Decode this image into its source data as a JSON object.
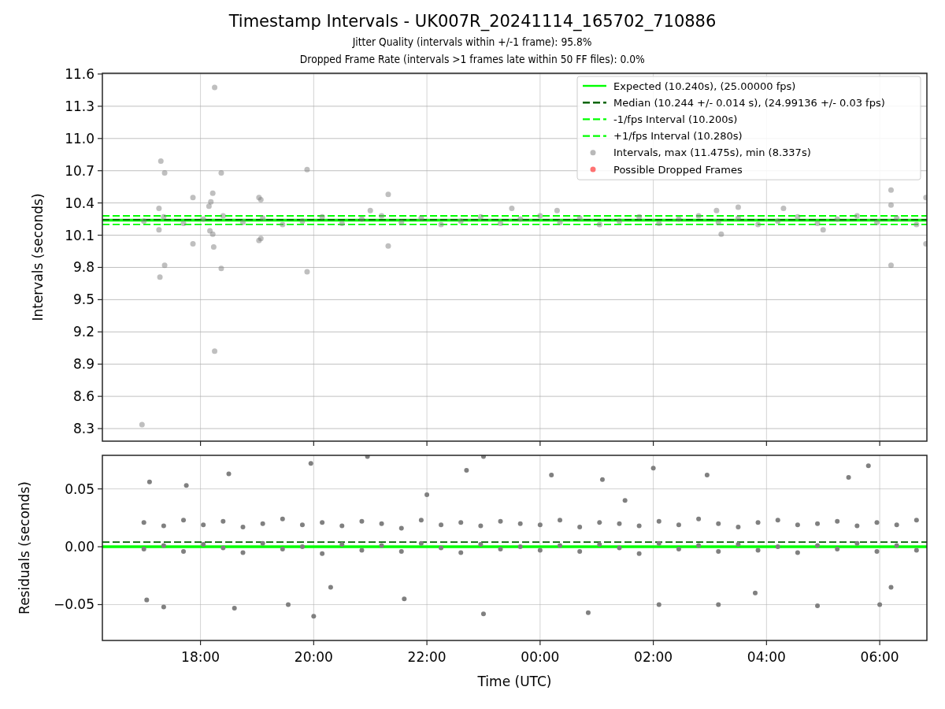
{
  "figure": {
    "title": "Timestamp Intervals - UK007R_20241114_165702_710886",
    "subtitles": [
      "Jitter Quality (intervals within +/-1 frame): 95.8%",
      "Dropped Frame Rate (intervals >1 frames late within 50 FF files): 0.0%"
    ]
  },
  "intervals_panel": {
    "chart_data": {
      "type": "scatter",
      "ylabel": "Intervals (seconds)",
      "xlim": [
        "2024-11-14 16:16",
        "2024-11-15 06:50"
      ],
      "ylim": [
        8.183,
        11.607
      ],
      "yticks": [
        {
          "value": 8.3,
          "label": "8.3"
        },
        {
          "value": 8.6,
          "label": "8.6"
        },
        {
          "value": 8.9,
          "label": "8.9"
        },
        {
          "value": 9.2,
          "label": "9.2"
        },
        {
          "value": 9.5,
          "label": "9.5"
        },
        {
          "value": 9.8,
          "label": "9.8"
        },
        {
          "value": 10.1,
          "label": "10.1"
        },
        {
          "value": 10.4,
          "label": "10.4"
        },
        {
          "value": 10.7,
          "label": "10.7"
        },
        {
          "value": 11.0,
          "label": "11.0"
        },
        {
          "value": 11.3,
          "label": "11.3"
        },
        {
          "value": 11.6,
          "label": "11.6"
        }
      ],
      "grid": true,
      "legend": "upper right",
      "series": [
        {
          "name": "Expected (10.240s), (25.00000 fps)",
          "type": "line",
          "line_style": "solid",
          "color": "#00ff00",
          "x": [
            "2024-11-14 16:16",
            "2024-11-15 06:50"
          ],
          "values": [
            10.24,
            10.24
          ]
        },
        {
          "name": "Median (10.244 +/- 0.014 s), (24.99136 +/- 0.03 fps)",
          "type": "line",
          "line_style": "dashed",
          "color": "#006400",
          "x": [
            "2024-11-14 16:16",
            "2024-11-15 06:50"
          ],
          "values": [
            10.244,
            10.244
          ]
        },
        {
          "name": "-1/fps Interval (10.200s)",
          "type": "line",
          "line_style": "dashed",
          "color": "#00ff00",
          "x": [
            "2024-11-14 16:16",
            "2024-11-15 06:50"
          ],
          "values": [
            10.2,
            10.2
          ]
        },
        {
          "name": "+1/fps Interval (10.280s)",
          "type": "line",
          "line_style": "dashed",
          "color": "#00ff00",
          "x": [
            "2024-11-14 16:16",
            "2024-11-15 06:50"
          ],
          "values": [
            10.28,
            10.28
          ]
        },
        {
          "name": "Intervals, max (11.475s), min (8.337s)",
          "color": "#808080",
          "x": [
            "2024-11-14 16:58",
            "2024-11-14 17:18",
            "2024-11-14 17:22",
            "2024-11-14 17:16",
            "2024-11-14 17:17",
            "2024-11-14 17:22",
            "2024-11-14 17:16",
            "2024-11-14 17:52",
            "2024-11-14 17:52",
            "2024-11-14 18:15",
            "2024-11-14 18:15",
            "2024-11-14 18:22",
            "2024-11-14 18:22",
            "2024-11-14 18:14",
            "2024-11-14 18:13",
            "2024-11-14 18:11",
            "2024-11-14 18:09",
            "2024-11-14 18:10",
            "2024-11-14 18:13",
            "2024-11-14 19:02",
            "2024-11-14 19:04",
            "2024-11-14 19:02",
            "2024-11-14 19:04",
            "2024-11-14 19:53",
            "2024-11-14 19:53",
            "2024-11-14 21:19",
            "2024-11-14 21:19",
            "2024-11-15 06:12",
            "2024-11-15 06:12",
            "2024-11-15 06:49",
            "2024-11-15 06:49",
            "2024-11-15 06:12",
            "2024-11-15 03:07",
            "2024-11-15 03:12",
            "2024-11-14 21:00",
            "2024-11-14 23:30",
            "2024-11-15 00:18",
            "2024-11-15 03:30",
            "2024-11-15 04:18",
            "2024-11-15 05:00",
            "2024-11-14 17:00",
            "2024-11-14 17:21",
            "2024-11-14 17:42",
            "2024-11-14 18:03",
            "2024-11-14 18:24",
            "2024-11-14 18:45",
            "2024-11-14 19:06",
            "2024-11-14 19:27",
            "2024-11-14 19:48",
            "2024-11-14 20:09",
            "2024-11-14 20:30",
            "2024-11-14 20:51",
            "2024-11-14 21:12",
            "2024-11-14 21:33",
            "2024-11-14 21:54",
            "2024-11-14 22:15",
            "2024-11-14 22:36",
            "2024-11-14 22:57",
            "2024-11-14 23:18",
            "2024-11-14 23:39",
            "2024-11-15 00:00",
            "2024-11-15 00:21",
            "2024-11-15 00:42",
            "2024-11-15 01:03",
            "2024-11-15 01:24",
            "2024-11-15 01:45",
            "2024-11-15 02:06",
            "2024-11-15 02:27",
            "2024-11-15 02:48",
            "2024-11-15 03:09",
            "2024-11-15 03:30",
            "2024-11-15 03:51",
            "2024-11-15 04:12",
            "2024-11-15 04:33",
            "2024-11-15 04:54",
            "2024-11-15 05:15",
            "2024-11-15 05:36",
            "2024-11-15 05:57",
            "2024-11-15 06:18",
            "2024-11-15 06:39"
          ],
          "values": [
            8.337,
            10.79,
            10.68,
            10.35,
            9.71,
            9.82,
            10.15,
            10.45,
            10.02,
            11.475,
            9.02,
            10.68,
            9.79,
            9.99,
            10.49,
            10.41,
            10.37,
            10.14,
            10.11,
            10.45,
            10.43,
            10.05,
            10.07,
            10.71,
            9.76,
            10.48,
            10.0,
            10.52,
            9.82,
            10.45,
            10.02,
            10.38,
            10.33,
            10.11,
            10.33,
            10.35,
            10.33,
            10.36,
            10.35,
            10.15,
            10.23,
            10.27,
            10.21,
            10.25,
            10.28,
            10.22,
            10.26,
            10.2,
            10.23,
            10.27,
            10.21,
            10.25,
            10.28,
            10.22,
            10.26,
            10.2,
            10.23,
            10.27,
            10.21,
            10.25,
            10.28,
            10.22,
            10.26,
            10.2,
            10.23,
            10.27,
            10.21,
            10.25,
            10.28,
            10.22,
            10.26,
            10.2,
            10.23,
            10.27,
            10.21,
            10.25,
            10.28,
            10.22,
            10.26,
            10.2
          ]
        },
        {
          "name": "Possible Dropped Frames",
          "color": "#ff0000"
        }
      ]
    }
  },
  "residuals_panel": {
    "chart_data": {
      "type": "scatter",
      "xlabel": "Time (UTC)",
      "ylabel": "Residuals (seconds)",
      "xlim": [
        "2024-11-14 16:16",
        "2024-11-15 06:50"
      ],
      "ylim": [
        -0.081,
        0.079
      ],
      "xticks": [
        {
          "value": "2024-11-14 18:00",
          "label": "18:00"
        },
        {
          "value": "2024-11-14 20:00",
          "label": "20:00"
        },
        {
          "value": "2024-11-14 22:00",
          "label": "22:00"
        },
        {
          "value": "2024-11-15 00:00",
          "label": "00:00"
        },
        {
          "value": "2024-11-15 02:00",
          "label": "02:00"
        },
        {
          "value": "2024-11-15 04:00",
          "label": "04:00"
        },
        {
          "value": "2024-11-15 06:00",
          "label": "06:00"
        }
      ],
      "yticks": [
        {
          "value": -0.05,
          "label": "−0.05"
        },
        {
          "value": 0,
          "label": "0.00"
        },
        {
          "value": 0.05,
          "label": "0.05"
        }
      ],
      "grid": true,
      "series": [
        {
          "type": "line",
          "line_style": "solid",
          "color": "#00ff00",
          "x": [
            "2024-11-14 16:16",
            "2024-11-15 06:50"
          ],
          "values": [
            0,
            0
          ]
        },
        {
          "type": "line",
          "line_style": "dashed",
          "color": "#006400",
          "x": [
            "2024-11-14 16:16",
            "2024-11-15 06:50"
          ],
          "values": [
            0.004,
            0.004
          ]
        },
        {
          "color": "#808080",
          "x": [
            "2024-11-14 17:00",
            "2024-11-14 17:21",
            "2024-11-14 17:42",
            "2024-11-14 18:03",
            "2024-11-14 18:24",
            "2024-11-14 18:45",
            "2024-11-14 19:06",
            "2024-11-14 19:27",
            "2024-11-14 19:48",
            "2024-11-14 20:09",
            "2024-11-14 20:30",
            "2024-11-14 20:51",
            "2024-11-14 21:12",
            "2024-11-14 21:33",
            "2024-11-14 21:54",
            "2024-11-14 22:15",
            "2024-11-14 22:36",
            "2024-11-14 22:57",
            "2024-11-14 23:18",
            "2024-11-14 23:39",
            "2024-11-15 00:00",
            "2024-11-15 00:21",
            "2024-11-15 00:42",
            "2024-11-15 01:03",
            "2024-11-15 01:24",
            "2024-11-15 01:45",
            "2024-11-15 02:06",
            "2024-11-15 02:27",
            "2024-11-15 02:48",
            "2024-11-15 03:09",
            "2024-11-15 03:30",
            "2024-11-15 03:51",
            "2024-11-15 04:12",
            "2024-11-15 04:33",
            "2024-11-15 04:54",
            "2024-11-15 05:15",
            "2024-11-15 05:36",
            "2024-11-15 05:57",
            "2024-11-15 06:18",
            "2024-11-15 06:39",
            "2024-11-14 17:00",
            "2024-11-14 17:21",
            "2024-11-14 17:42",
            "2024-11-14 18:03",
            "2024-11-14 18:24",
            "2024-11-14 18:45",
            "2024-11-14 19:06",
            "2024-11-14 19:27",
            "2024-11-14 19:48",
            "2024-11-14 20:09",
            "2024-11-14 20:30",
            "2024-11-14 20:51",
            "2024-11-14 21:12",
            "2024-11-14 21:33",
            "2024-11-14 21:54",
            "2024-11-14 22:15",
            "2024-11-14 22:36",
            "2024-11-14 22:57",
            "2024-11-14 23:18",
            "2024-11-14 23:39",
            "2024-11-15 00:00",
            "2024-11-15 00:21",
            "2024-11-15 00:42",
            "2024-11-15 01:03",
            "2024-11-15 01:24",
            "2024-11-15 01:45",
            "2024-11-15 02:06",
            "2024-11-15 02:27",
            "2024-11-15 02:48",
            "2024-11-15 03:09",
            "2024-11-15 03:30",
            "2024-11-15 03:51",
            "2024-11-15 04:12",
            "2024-11-15 04:33",
            "2024-11-15 04:54",
            "2024-11-15 05:15",
            "2024-11-15 05:36",
            "2024-11-15 05:57",
            "2024-11-15 06:18",
            "2024-11-15 06:39",
            "2024-11-14 17:06",
            "2024-11-14 17:03",
            "2024-11-14 17:21",
            "2024-11-14 17:45",
            "2024-11-14 18:30",
            "2024-11-14 18:36",
            "2024-11-14 19:33",
            "2024-11-14 19:57",
            "2024-11-14 20:00",
            "2024-11-14 20:57",
            "2024-11-14 21:36",
            "2024-11-14 22:42",
            "2024-11-14 23:00",
            "2024-11-14 23:00",
            "2024-11-15 00:12",
            "2024-11-15 00:51",
            "2024-11-15 01:06",
            "2024-11-15 02:00",
            "2024-11-15 02:06",
            "2024-11-15 02:57",
            "2024-11-15 03:09",
            "2024-11-15 04:54",
            "2024-11-15 05:27",
            "2024-11-15 06:00",
            "2024-11-15 05:48",
            "2024-11-15 06:12",
            "2024-11-14 20:18",
            "2024-11-14 22:00",
            "2024-11-15 01:30",
            "2024-11-15 03:48"
          ],
          "values": [
            0.021,
            0.018,
            0.023,
            0.019,
            0.022,
            0.017,
            0.02,
            0.024,
            0.019,
            0.021,
            0.018,
            0.022,
            0.02,
            0.016,
            0.023,
            0.019,
            0.021,
            0.018,
            0.022,
            0.02,
            0.019,
            0.023,
            0.017,
            0.021,
            0.02,
            0.018,
            0.022,
            0.019,
            0.024,
            0.02,
            0.017,
            0.021,
            0.023,
            0.019,
            0.02,
            0.022,
            0.018,
            0.021,
            0.019,
            0.023,
            -0.002,
            0.001,
            -0.004,
            0.002,
            -0.001,
            -0.005,
            0.003,
            -0.002,
            0.0,
            -0.006,
            0.002,
            -0.003,
            0.001,
            -0.004,
            0.003,
            -0.001,
            -0.005,
            0.002,
            -0.002,
            0.0,
            -0.003,
            0.001,
            -0.004,
            0.002,
            -0.001,
            -0.006,
            0.003,
            -0.002,
            0.001,
            -0.004,
            0.002,
            -0.003,
            0.0,
            -0.005,
            0.001,
            -0.002,
            0.003,
            -0.004,
            0.001,
            -0.003,
            0.056,
            -0.046,
            -0.052,
            0.053,
            0.063,
            -0.053,
            -0.05,
            0.072,
            -0.06,
            0.078,
            -0.045,
            0.066,
            0.078,
            -0.058,
            0.062,
            -0.057,
            0.058,
            0.068,
            -0.05,
            0.062,
            -0.05,
            -0.051,
            0.06,
            -0.05,
            0.07,
            -0.035,
            -0.035,
            0.045,
            0.04,
            -0.04
          ]
        }
      ]
    }
  }
}
